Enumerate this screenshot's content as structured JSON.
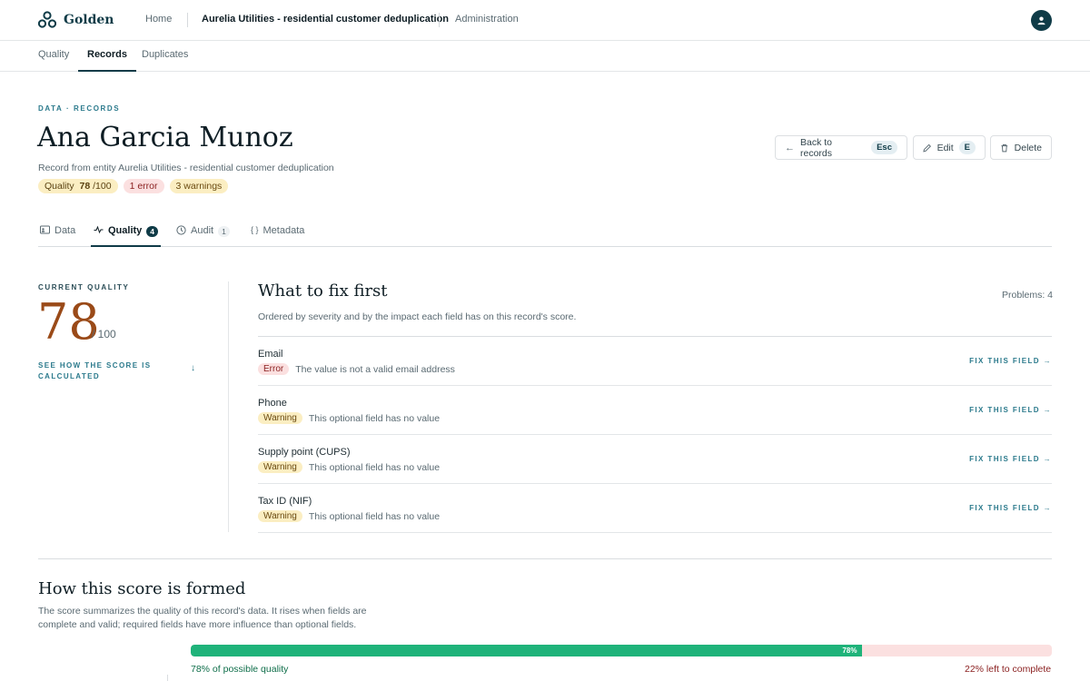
{
  "app": {
    "name": "Golden"
  },
  "nav": {
    "home": "Home",
    "entity": "Aurelia Utilities - residential customer deduplication",
    "admin": "Administration"
  },
  "subnav": {
    "quality": "Quality",
    "records": "Records",
    "duplicates": "Duplicates",
    "active": "Records"
  },
  "breadcrumb": "DATA · RECORDS",
  "record": {
    "name": "Ana Garcia Munoz",
    "subtitle": "Record from entity Aurelia Utilities - residential customer deduplication",
    "quality_label": "Quality",
    "quality_value": "78",
    "quality_max": "/100",
    "errors": "1 error",
    "warnings": "3 warnings"
  },
  "actions": {
    "back": "Back to records",
    "back_key": "Esc",
    "edit": "Edit",
    "edit_key": "E",
    "delete": "Delete"
  },
  "tabs": [
    {
      "label": "Data",
      "count": ""
    },
    {
      "label": "Quality",
      "count": "4",
      "active": true
    },
    {
      "label": "Audit",
      "count": "1"
    },
    {
      "label": "Metadata",
      "count": ""
    }
  ],
  "score_panel": {
    "label": "CURRENT QUALITY",
    "score": "78",
    "of": "/ 100",
    "link": "SEE HOW THE SCORE IS CALCULATED",
    "arrow": "↓"
  },
  "fix_first": {
    "title": "What to fix first",
    "problems": "Problems: 4",
    "subtitle": "Ordered by severity and by the impact each field has on this record's score.",
    "fix_label": "FIX THIS FIELD",
    "rows": [
      {
        "field": "Email",
        "severity": "Error",
        "level": "error",
        "message": "The value is not a valid email address"
      },
      {
        "field": "Phone",
        "severity": "Warning",
        "level": "warning",
        "message": "This optional field has no value"
      },
      {
        "field": "Supply point (CUPS)",
        "severity": "Warning",
        "level": "warning",
        "message": "This optional field has no value"
      },
      {
        "field": "Tax ID (NIF)",
        "severity": "Warning",
        "level": "warning",
        "message": "This optional field has no value"
      }
    ]
  },
  "how": {
    "title": "How this score is formed",
    "description": "The score summarizes the quality of this record's data. It rises when fields are complete and valid; required fields have more influence than optional fields.",
    "progress": 0.78,
    "progress_label": "78%",
    "left_text": "78% of possible quality",
    "right_text": "22% left to complete"
  },
  "colors": {
    "brand": "#0f3b47",
    "accent": "#2b7a8c",
    "score": "#9a4a18",
    "progress": "#1fb37a",
    "remaining": "#fbe0e0"
  }
}
